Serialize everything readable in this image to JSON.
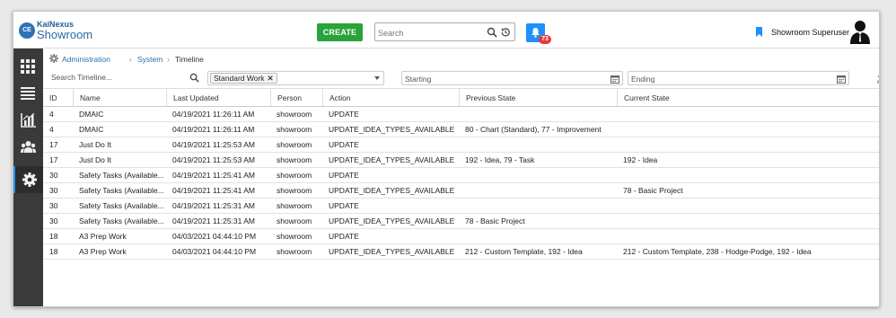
{
  "app": {
    "logo_badge": "CE",
    "brand": "KaiNexus",
    "product": "Showroom"
  },
  "header": {
    "create_label": "CREATE",
    "search_placeholder": "Search",
    "notification_count": "73",
    "user_name": "Showroom Superuser"
  },
  "sidebar": {
    "items": [
      {
        "icon": "grid-icon"
      },
      {
        "icon": "list-icon"
      },
      {
        "icon": "chart-icon"
      },
      {
        "icon": "people-icon"
      },
      {
        "icon": "gear-icon",
        "active": true
      }
    ]
  },
  "breadcrumb": {
    "items": [
      "Administration",
      "System",
      "Timeline"
    ]
  },
  "filters": {
    "search_placeholder": "Search Timeline...",
    "tag": "Standard Work",
    "start_placeholder": "Starting",
    "end_placeholder": "Ending"
  },
  "table": {
    "columns": [
      "ID",
      "Name",
      "Last Updated",
      "Person",
      "Action",
      "Previous State",
      "Current State"
    ],
    "rows": [
      [
        "4",
        "DMAIC",
        "04/19/2021 11:26:11 AM",
        "showroom",
        "UPDATE",
        "",
        ""
      ],
      [
        "4",
        "DMAIC",
        "04/19/2021 11:26:11 AM",
        "showroom",
        "UPDATE_IDEA_TYPES_AVAILABLE",
        "80 - Chart (Standard), 77 - Improvement",
        ""
      ],
      [
        "17",
        "Just Do It",
        "04/19/2021 11:25:53 AM",
        "showroom",
        "UPDATE",
        "",
        ""
      ],
      [
        "17",
        "Just Do It",
        "04/19/2021 11:25:53 AM",
        "showroom",
        "UPDATE_IDEA_TYPES_AVAILABLE",
        "192 - Idea, 79 - Task",
        "192 - Idea"
      ],
      [
        "30",
        "Safety Tasks (Available...",
        "04/19/2021 11:25:41 AM",
        "showroom",
        "UPDATE",
        "",
        ""
      ],
      [
        "30",
        "Safety Tasks (Available...",
        "04/19/2021 11:25:41 AM",
        "showroom",
        "UPDATE_IDEA_TYPES_AVAILABLE",
        "",
        "78 - Basic Project"
      ],
      [
        "30",
        "Safety Tasks (Available...",
        "04/19/2021 11:25:31 AM",
        "showroom",
        "UPDATE",
        "",
        ""
      ],
      [
        "30",
        "Safety Tasks (Available...",
        "04/19/2021 11:25:31 AM",
        "showroom",
        "UPDATE_IDEA_TYPES_AVAILABLE",
        "78 - Basic Project",
        ""
      ],
      [
        "18",
        "A3 Prep Work",
        "04/03/2021 04:44:10 PM",
        "showroom",
        "UPDATE",
        "",
        ""
      ],
      [
        "18",
        "A3 Prep Work",
        "04/03/2021 04:44:10 PM",
        "showroom",
        "UPDATE_IDEA_TYPES_AVAILABLE",
        "212 - Custom Template, 192 - Idea",
        "212 - Custom Template, 238 - Hodge-Podge, 192 - Idea"
      ]
    ]
  },
  "colors": {
    "create_green": "#29a33a",
    "accent_blue": "#1e90ff",
    "link_blue": "#1f6fb2",
    "sidebar_bg": "#3a3a3a",
    "badge_red": "#e53935"
  }
}
